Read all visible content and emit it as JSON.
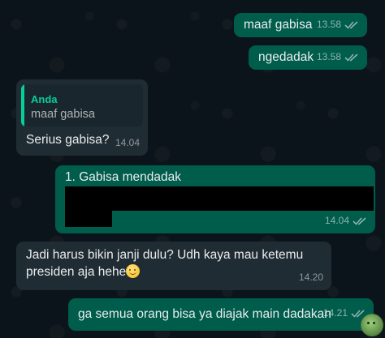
{
  "messages": [
    {
      "text": "maaf gabisa",
      "time": "13.58"
    },
    {
      "text": "ngedadak",
      "time": "13.58"
    },
    {
      "quote_author": "Anda",
      "quote_text": "maaf gabisa",
      "text": "Serius gabisa?",
      "time": "14.04"
    },
    {
      "text": "1. Gabisa mendadak",
      "time": "14.04"
    },
    {
      "line1": "Jadi harus bikin janji dulu? Udh kaya mau ketemu",
      "line2": "presiden aja hehe",
      "emoji": "smiling-face-emoji",
      "time": "14.20"
    },
    {
      "text": "ga semua orang bisa ya diajak main dadakan",
      "time": "14.21"
    }
  ],
  "icons": {
    "read_ticks": "double-check-icon",
    "avatar": "frog-sticker-icon"
  },
  "colors": {
    "background": "#0b141a",
    "outgoing_bubble": "#005c4b",
    "incoming_bubble": "#202c33",
    "quote_accent": "#06cf9c"
  }
}
